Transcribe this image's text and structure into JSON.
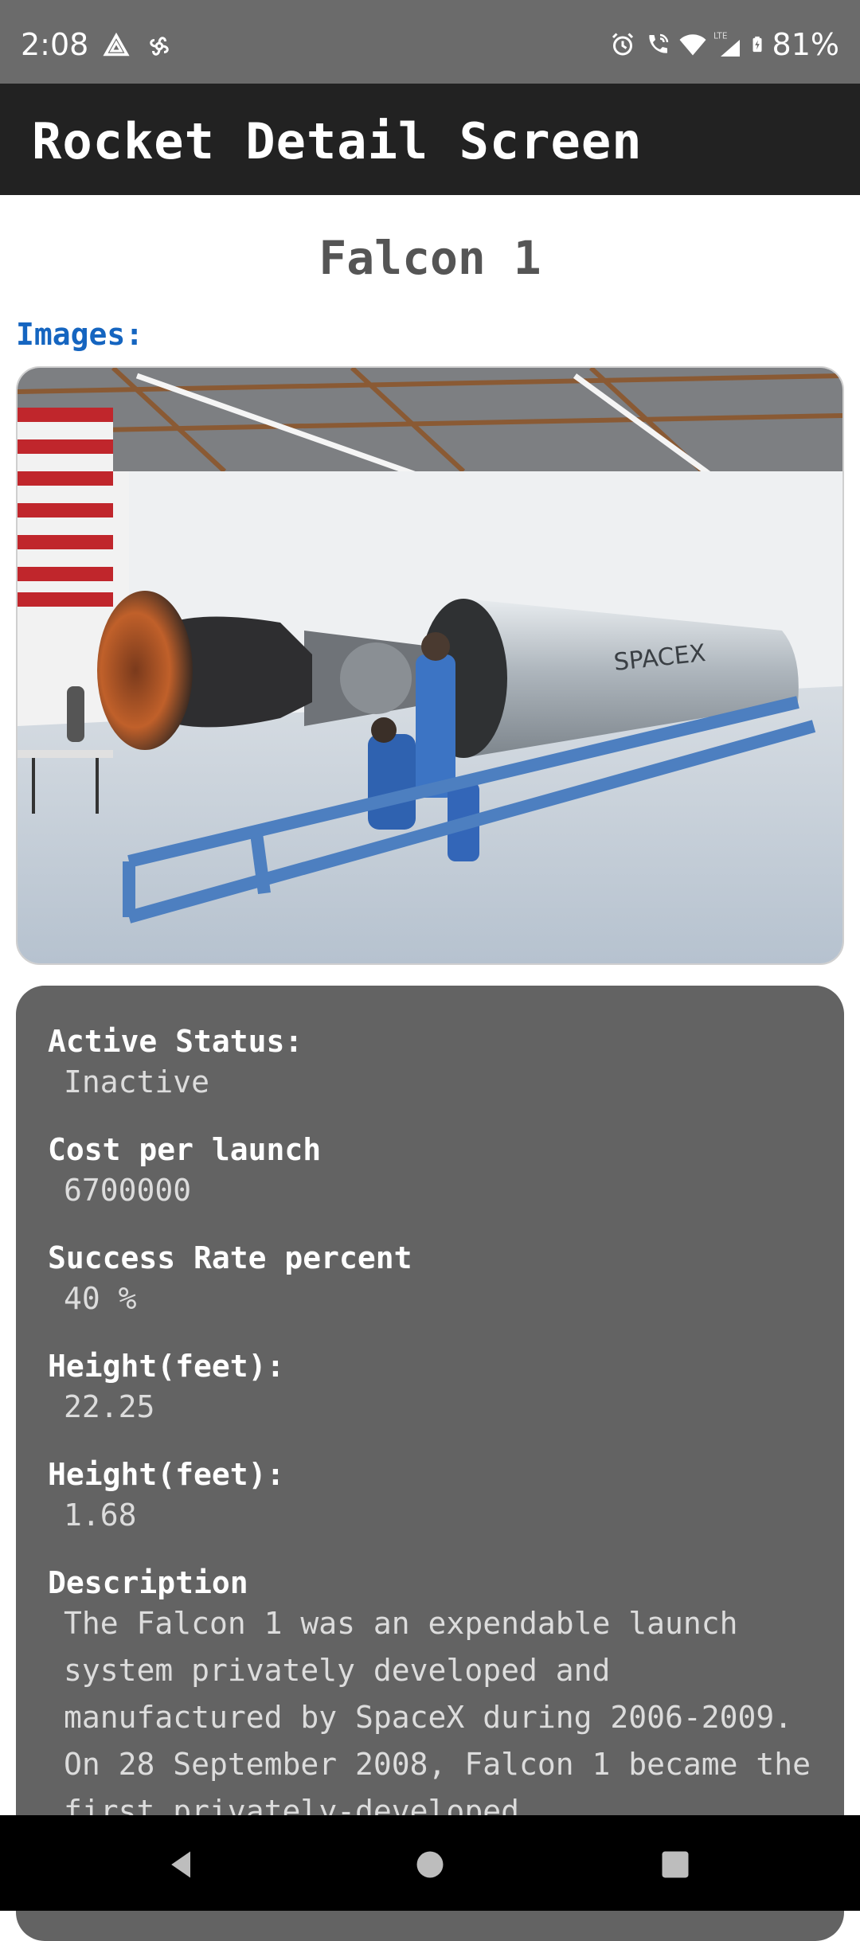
{
  "status_bar": {
    "time": "2:08",
    "battery": "81%",
    "icons": [
      "drive-icon",
      "pinwheel-icon",
      "alarm-icon",
      "wifi-call-icon",
      "wifi-icon",
      "lte-signal-icon",
      "battery-icon"
    ]
  },
  "app_bar": {
    "title": "Rocket Detail Screen"
  },
  "rocket": {
    "name": "Falcon 1",
    "images_label": "Images:"
  },
  "details": {
    "active_status": {
      "label": "Active Status:",
      "value": "Inactive"
    },
    "cost_per_launch": {
      "label": "Cost per launch",
      "value": "6700000"
    },
    "success_rate": {
      "label": "Success Rate percent",
      "value": "40 %"
    },
    "height": {
      "label": "Height(feet):",
      "value": "22.25"
    },
    "diameter": {
      "label": "Height(feet):",
      "value": "1.68"
    },
    "description": {
      "label": "Description",
      "value": "The Falcon 1 was an expendable launch system privately developed and manufactured by SpaceX during 2006-2009. On 28 September 2008, Falcon 1 became the first privately-developed"
    }
  },
  "colors": {
    "status_bar_bg": "#6b6b6b",
    "app_bar_bg": "#222222",
    "card_bg": "#636363",
    "accent_blue": "#1565c0"
  }
}
